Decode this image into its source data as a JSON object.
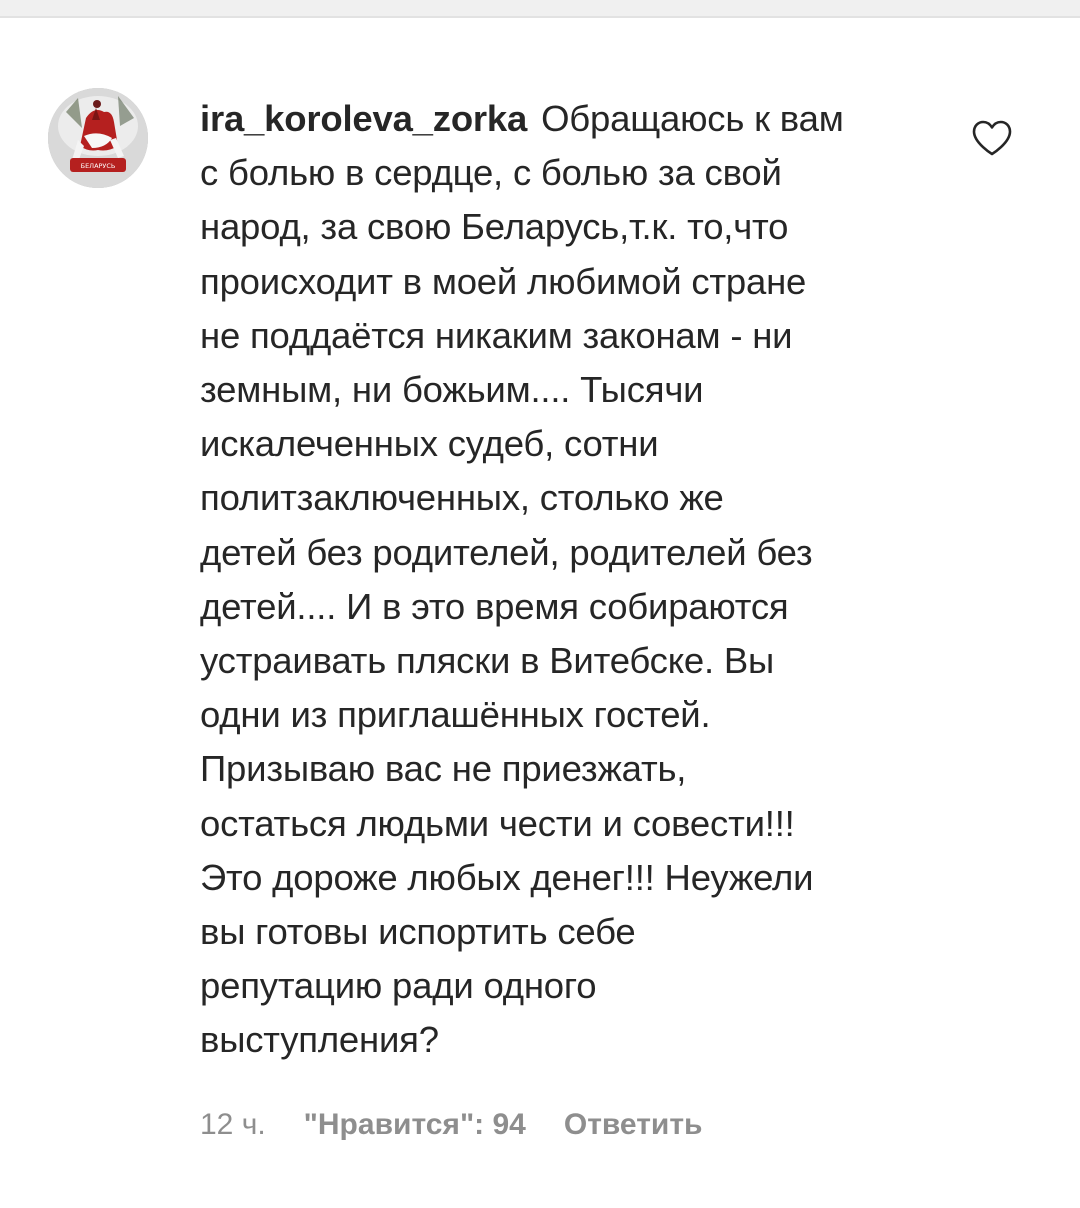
{
  "comment": {
    "username": "ira_koroleva_zorka",
    "avatar_icon": "avatar-pahonia-emblem",
    "avatar_caption": "БЕЛАРУСЬ",
    "lines": [
      "Обращаюсь к вам",
      "с болью в сердце, с болью за свой",
      "народ, за свою Беларусь,т.к. то,что",
      "происходит в моей любимой стране",
      "не поддаётся никаким законам - ни",
      "земным, ни божьим.... Тысячи",
      "искалеченных судеб, сотни",
      "политзаключенных, столько же",
      "детей без родителей, родителей без",
      "детей.... И в это время собираются",
      "устраивать пляски в Витебске. Вы",
      "одни из приглашённых гостей.",
      "Призываю вас не приезжать,",
      "остаться людьми чести и совести!!!",
      "Это дороже любых денег!!! Неужели",
      "вы готовы испортить себе",
      "репутацию ради одного",
      "выступления?"
    ],
    "like_icon": "heart-outline-icon"
  },
  "meta": {
    "time": "12 ч.",
    "likes": "\"Нравится\": 94",
    "reply": "Ответить"
  },
  "colors": {
    "text": "#262626",
    "secondary": "#8e8e8e",
    "avatar_accent": "#b5201f"
  }
}
